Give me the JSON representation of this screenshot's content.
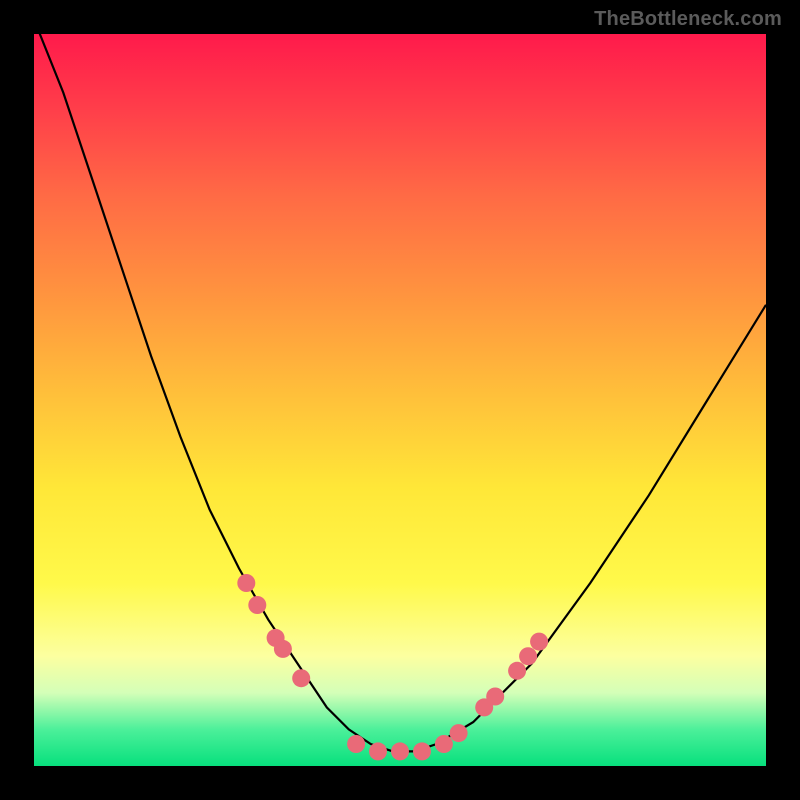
{
  "watermark": "TheBottleneck.com",
  "chart_data": {
    "type": "line",
    "title": "",
    "xlabel": "",
    "ylabel": "",
    "xlim": [
      0,
      100
    ],
    "ylim": [
      0,
      100
    ],
    "grid": false,
    "legend": false,
    "series": [
      {
        "name": "bottleneck-curve",
        "x": [
          0,
          4,
          8,
          12,
          16,
          20,
          24,
          28,
          32,
          36,
          40,
          43,
          46,
          49,
          52,
          55,
          60,
          68,
          76,
          84,
          92,
          100
        ],
        "y": [
          102,
          92,
          80,
          68,
          56,
          45,
          35,
          27,
          20,
          14,
          8,
          5,
          3,
          2,
          2,
          3,
          6,
          14,
          25,
          37,
          50,
          63
        ],
        "color": "#000000"
      }
    ],
    "markers_left": {
      "name": "left-cluster-markers",
      "color": "#e96a78",
      "x": [
        29,
        30.5,
        33,
        34,
        36.5,
        44,
        47,
        50
      ],
      "y": [
        25,
        22,
        17.5,
        16,
        12,
        3,
        2,
        2
      ]
    },
    "markers_right": {
      "name": "right-cluster-markers",
      "color": "#e96a78",
      "x": [
        53,
        56,
        58,
        61.5,
        63,
        66,
        67.5,
        69
      ],
      "y": [
        2,
        3,
        4.5,
        8,
        9.5,
        13,
        15,
        17
      ]
    },
    "annotations": []
  }
}
